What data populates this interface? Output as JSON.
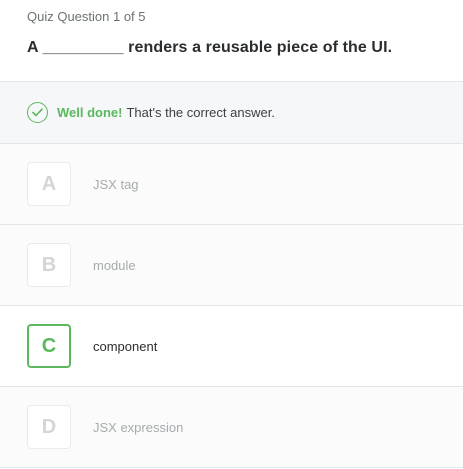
{
  "quiz": {
    "counter": "Quiz Question 1 of 5",
    "question": "A _________ renders a reusable piece of the UI."
  },
  "feedback": {
    "status": "Well done!",
    "message": "That's the correct answer.",
    "icon": "check-circle-icon",
    "color": "#5cb85c"
  },
  "options": [
    {
      "letter": "A",
      "label": "JSX tag",
      "state": "disabled"
    },
    {
      "letter": "B",
      "label": "module",
      "state": "disabled"
    },
    {
      "letter": "C",
      "label": "component",
      "state": "selected"
    },
    {
      "letter": "D",
      "label": "JSX expression",
      "state": "disabled"
    }
  ]
}
